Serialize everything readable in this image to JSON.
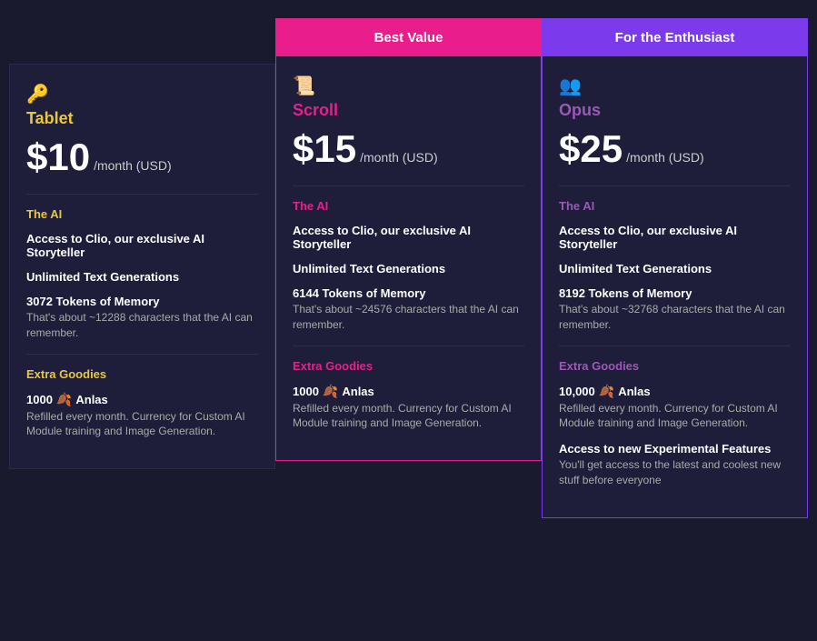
{
  "tablet": {
    "banner": null,
    "icon": "🔑",
    "name": "Tablet",
    "price": "$10",
    "price_suffix": "/month (USD)",
    "ai_section_title": "The AI",
    "features": [
      {
        "title": "Access to Clio, our exclusive AI Storyteller",
        "desc": ""
      },
      {
        "title": "Unlimited Text Generations",
        "desc": ""
      },
      {
        "title": "3072 Tokens of Memory",
        "desc": "That's about ~12288 characters that the AI can remember."
      }
    ],
    "goodies_title": "Extra Goodies",
    "goodies": [
      {
        "title": "1000",
        "anlas_label": "Anlas",
        "desc": "Refilled every month. Currency for Custom AI Module training and Image Generation."
      }
    ]
  },
  "scroll": {
    "banner": "Best Value",
    "icon": "📜",
    "name": "Scroll",
    "price": "$15",
    "price_suffix": "/month (USD)",
    "ai_section_title": "The AI",
    "features": [
      {
        "title": "Access to Clio, our exclusive AI Storyteller",
        "desc": ""
      },
      {
        "title": "Unlimited Text Generations",
        "desc": ""
      },
      {
        "title": "6144 Tokens of Memory",
        "desc": "That's about ~24576 characters that the AI can remember."
      }
    ],
    "goodies_title": "Extra Goodies",
    "goodies": [
      {
        "title": "1000",
        "anlas_label": "Anlas",
        "desc": "Refilled every month. Currency for Custom AI Module training and Image Generation."
      }
    ]
  },
  "opus": {
    "banner": "For the Enthusiast",
    "icon": "👥",
    "name": "Opus",
    "price": "$25",
    "price_suffix": "/month (USD)",
    "ai_section_title": "The AI",
    "features": [
      {
        "title": "Access to Clio, our exclusive AI Storyteller",
        "desc": ""
      },
      {
        "title": "Unlimited Text Generations",
        "desc": ""
      },
      {
        "title": "8192 Tokens of Memory",
        "desc": "That's about ~32768 characters that the AI can remember."
      }
    ],
    "goodies_title": "Extra Goodies",
    "goodies": [
      {
        "title": "10,000",
        "anlas_label": "Anlas",
        "desc": "Refilled every month. Currency for Custom AI Module training and Image Generation."
      },
      {
        "title": "Access to new Experimental Features",
        "desc": "You'll get access to the latest and coolest new stuff before everyone"
      }
    ]
  }
}
